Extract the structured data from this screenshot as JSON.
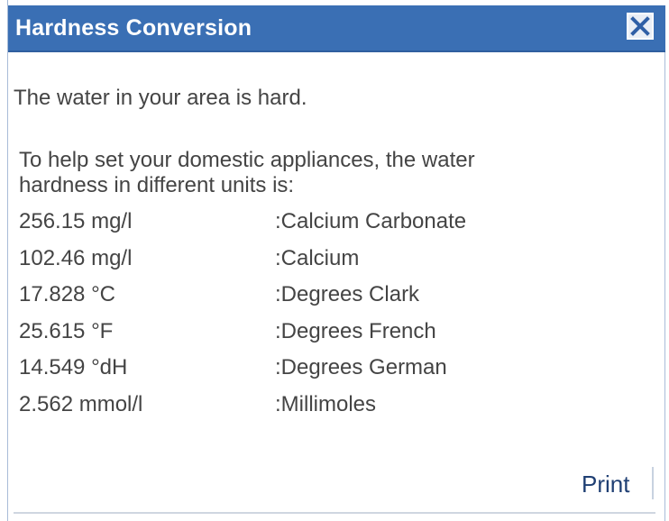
{
  "dialog": {
    "title": "Hardness Conversion",
    "intro": "The water in your area is hard.",
    "help_line1": "To help set your domestic appliances, the water",
    "help_line2": "hardness in different units is:",
    "units": [
      {
        "value": "256.15 mg/l",
        "name": ":Calcium Carbonate"
      },
      {
        "value": "102.46 mg/l",
        "name": ":Calcium"
      },
      {
        "value": "17.828 °C",
        "name": ":Degrees Clark"
      },
      {
        "value": "25.615 °F",
        "name": ":Degrees French"
      },
      {
        "value": "14.549 °dH",
        "name": ":Degrees German"
      },
      {
        "value": "2.562 mmol/l",
        "name": ":Millimoles"
      }
    ],
    "print_label": "Print"
  },
  "icons": {
    "close": "close-icon"
  },
  "colors": {
    "titlebar": "#3a6fb4",
    "text": "#444444",
    "print": "#1f3f73"
  }
}
